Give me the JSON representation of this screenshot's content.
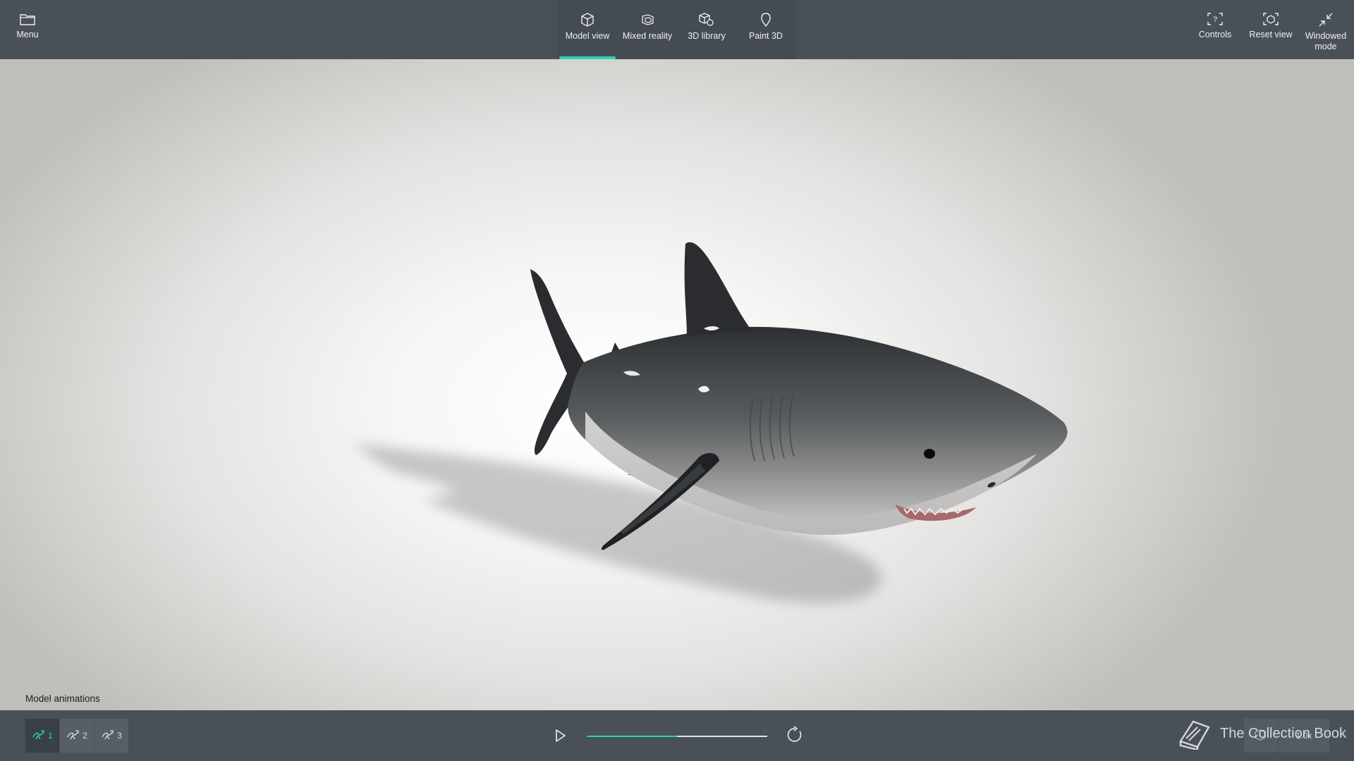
{
  "topbar": {
    "menu_label": "Menu",
    "tabs": [
      {
        "label": "Model view"
      },
      {
        "label": "Mixed reality"
      },
      {
        "label": "3D library"
      },
      {
        "label": "Paint 3D"
      }
    ],
    "controls_label": "Controls",
    "reset_label": "Reset view",
    "windowed_line1": "Windowed",
    "windowed_line2": "mode"
  },
  "animations": {
    "title": "Model animations",
    "items": [
      {
        "label": "1"
      },
      {
        "label": "2"
      },
      {
        "label": "3"
      }
    ],
    "selected": 0
  },
  "playback": {
    "progress": 0.5,
    "speed_label": "1.0x"
  },
  "watermark": "The Collection Book",
  "colors": {
    "accent": "#2ed2b0",
    "bar": "#4a5058"
  }
}
